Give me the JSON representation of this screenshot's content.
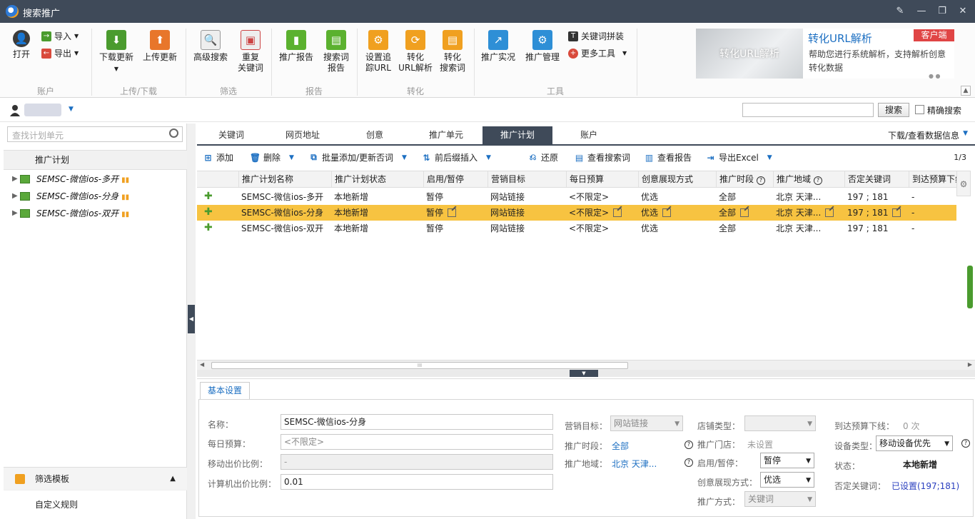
{
  "app": {
    "title": "搜索推广"
  },
  "ribbon": {
    "open": "打开",
    "import": "导入",
    "export": "导出",
    "download_update": "下载更新",
    "upload_update": "上传更新",
    "advanced_search": "高级搜索",
    "dup_keywords_1": "重复",
    "dup_keywords_2": "关键词",
    "promo_report": "推广报告",
    "search_term_1": "搜索词",
    "search_term_2": "报告",
    "track_url_1": "设置追",
    "track_url_2": "踪URL",
    "conv_url_1": "转化",
    "conv_url_2": "URL解析",
    "conv_search_1": "转化",
    "conv_search_2": "搜索词",
    "promo_live": "推广实况",
    "promo_manage": "推广管理",
    "keyword_combine": "关键词拼装",
    "more_tools": "更多工具",
    "groups": {
      "account": "账户",
      "upload": "上传/下载",
      "filter": "筛选",
      "report": "报告",
      "convert": "转化",
      "tools": "工具"
    }
  },
  "promo": {
    "image_text": "转化URL解析",
    "title": "转化URL解析",
    "desc": "帮助您进行系统解析，支持解析创意转化数据",
    "tag": "客户端",
    "dots": "● ●"
  },
  "accbar": {
    "search_btn": "搜索",
    "exact_search": "精确搜索"
  },
  "left": {
    "search_placeholder": "查找计划单元",
    "header": "推广计划",
    "items": [
      {
        "label": "SEMSC-微信ios-多开"
      },
      {
        "label": "SEMSC-微信ios-分身"
      },
      {
        "label": "SEMSC-微信ios-双开"
      }
    ],
    "filter_template": "筛选模板",
    "custom_rule": "自定义规则"
  },
  "tabs": {
    "items": [
      "关键词",
      "网页地址",
      "创意",
      "推广单元",
      "推广计划",
      "账户"
    ],
    "active": 4,
    "download_view": "下载/查看数据信息"
  },
  "toolbar": {
    "add": "添加",
    "delete": "删除",
    "batch_add": "批量添加/更新否词",
    "insert": "前后缀插入",
    "restore": "还原",
    "view_search_terms": "查看搜索词",
    "view_report": "查看报告",
    "export_excel": "导出Excel",
    "page": "1/3"
  },
  "grid": {
    "columns": [
      "推广计划名称",
      "推广计划状态",
      "启用/暂停",
      "营销目标",
      "每日预算",
      "创意展现方式",
      "推广时段",
      "推广地域",
      "否定关键词",
      "到达预算下线"
    ],
    "rows": [
      [
        "SEMSC-微信ios-多开",
        "本地新增",
        "暂停",
        "网站链接",
        "<不限定>",
        "优选",
        "全部",
        "北京 天津...",
        "197 ; 181",
        "-"
      ],
      [
        "SEMSC-微信ios-分身",
        "本地新增",
        "暂停",
        "网站链接",
        "<不限定>",
        "优选",
        "全部",
        "北京 天津...",
        "197 ; 181",
        "-"
      ],
      [
        "SEMSC-微信ios-双开",
        "本地新增",
        "暂停",
        "网站链接",
        "<不限定>",
        "优选",
        "全部",
        "北京 天津...",
        "197 ; 181",
        "-"
      ]
    ],
    "selected_row": 1,
    "gear": "⚙",
    "hscroll_grip": "III"
  },
  "basic": {
    "tab": "基本设置",
    "name_label": "名称：",
    "name_value": "SEMSC-微信ios-分身",
    "budget_label": "每日预算：",
    "budget_placeholder": "<不限定>",
    "mobile_ratio_label": "移动出价比例：",
    "mobile_ratio_value": "-",
    "pc_ratio_label": "计算机出价比例：",
    "pc_ratio_value": "0.01",
    "target_label": "营销目标：",
    "target_value": "网站链接",
    "time_label": "推广时段：",
    "time_value": "全部",
    "region_label": "推广地域：",
    "region_value": "北京 天津...",
    "shop_type_label": "店铺类型：",
    "shop_type_value": "",
    "store_label": "推广门店：",
    "store_value": "未设置",
    "enable_label": "启用/暂停：",
    "enable_value": "暂停",
    "creative_label": "创意展现方式：",
    "creative_value": "优选",
    "method_label": "推广方式：",
    "method_value": "关键词",
    "budget_offline_label": "到达预算下线：",
    "budget_offline_value": "0 次",
    "device_label": "设备类型：",
    "device_value": "移动设备优先",
    "status_label": "状态：",
    "status_value": "本地新增",
    "neg_kw_label": "否定关键词：",
    "neg_kw_value": "已设置(197;181)"
  },
  "colors": {
    "accent": "#3f4a59",
    "selected_row": "#f7c341",
    "link": "#1c6fc2",
    "green": "#4a9b2e"
  }
}
